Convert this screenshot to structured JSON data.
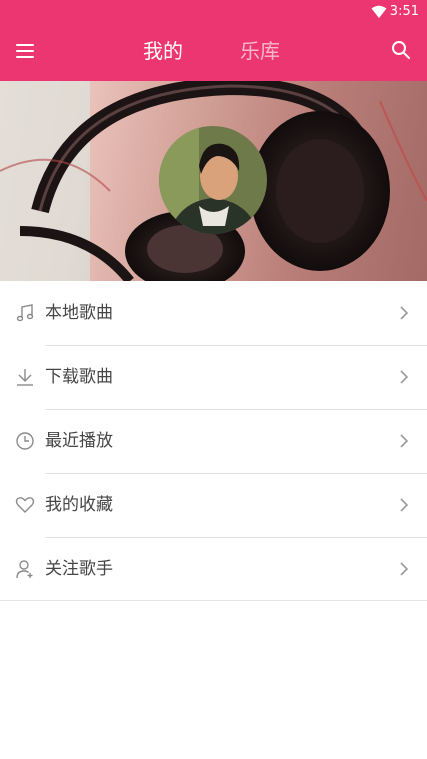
{
  "status_bar": {
    "time": "3:51",
    "wifi_icon": "wifi-icon"
  },
  "app_bar": {
    "menu_icon": "menu-icon",
    "tabs": [
      {
        "label": "我的",
        "active": true
      },
      {
        "label": "乐库",
        "active": false
      }
    ],
    "search_icon": "search-icon",
    "color": "#ec3671"
  },
  "banner": {
    "avatar": "profile-avatar"
  },
  "menu_items": [
    {
      "label": "本地歌曲",
      "icon": "music-note-icon"
    },
    {
      "label": "下载歌曲",
      "icon": "download-icon"
    },
    {
      "label": "最近播放",
      "icon": "clock-icon"
    },
    {
      "label": "我的收藏",
      "icon": "heart-icon"
    },
    {
      "label": "关注歌手",
      "icon": "user-add-icon"
    }
  ]
}
